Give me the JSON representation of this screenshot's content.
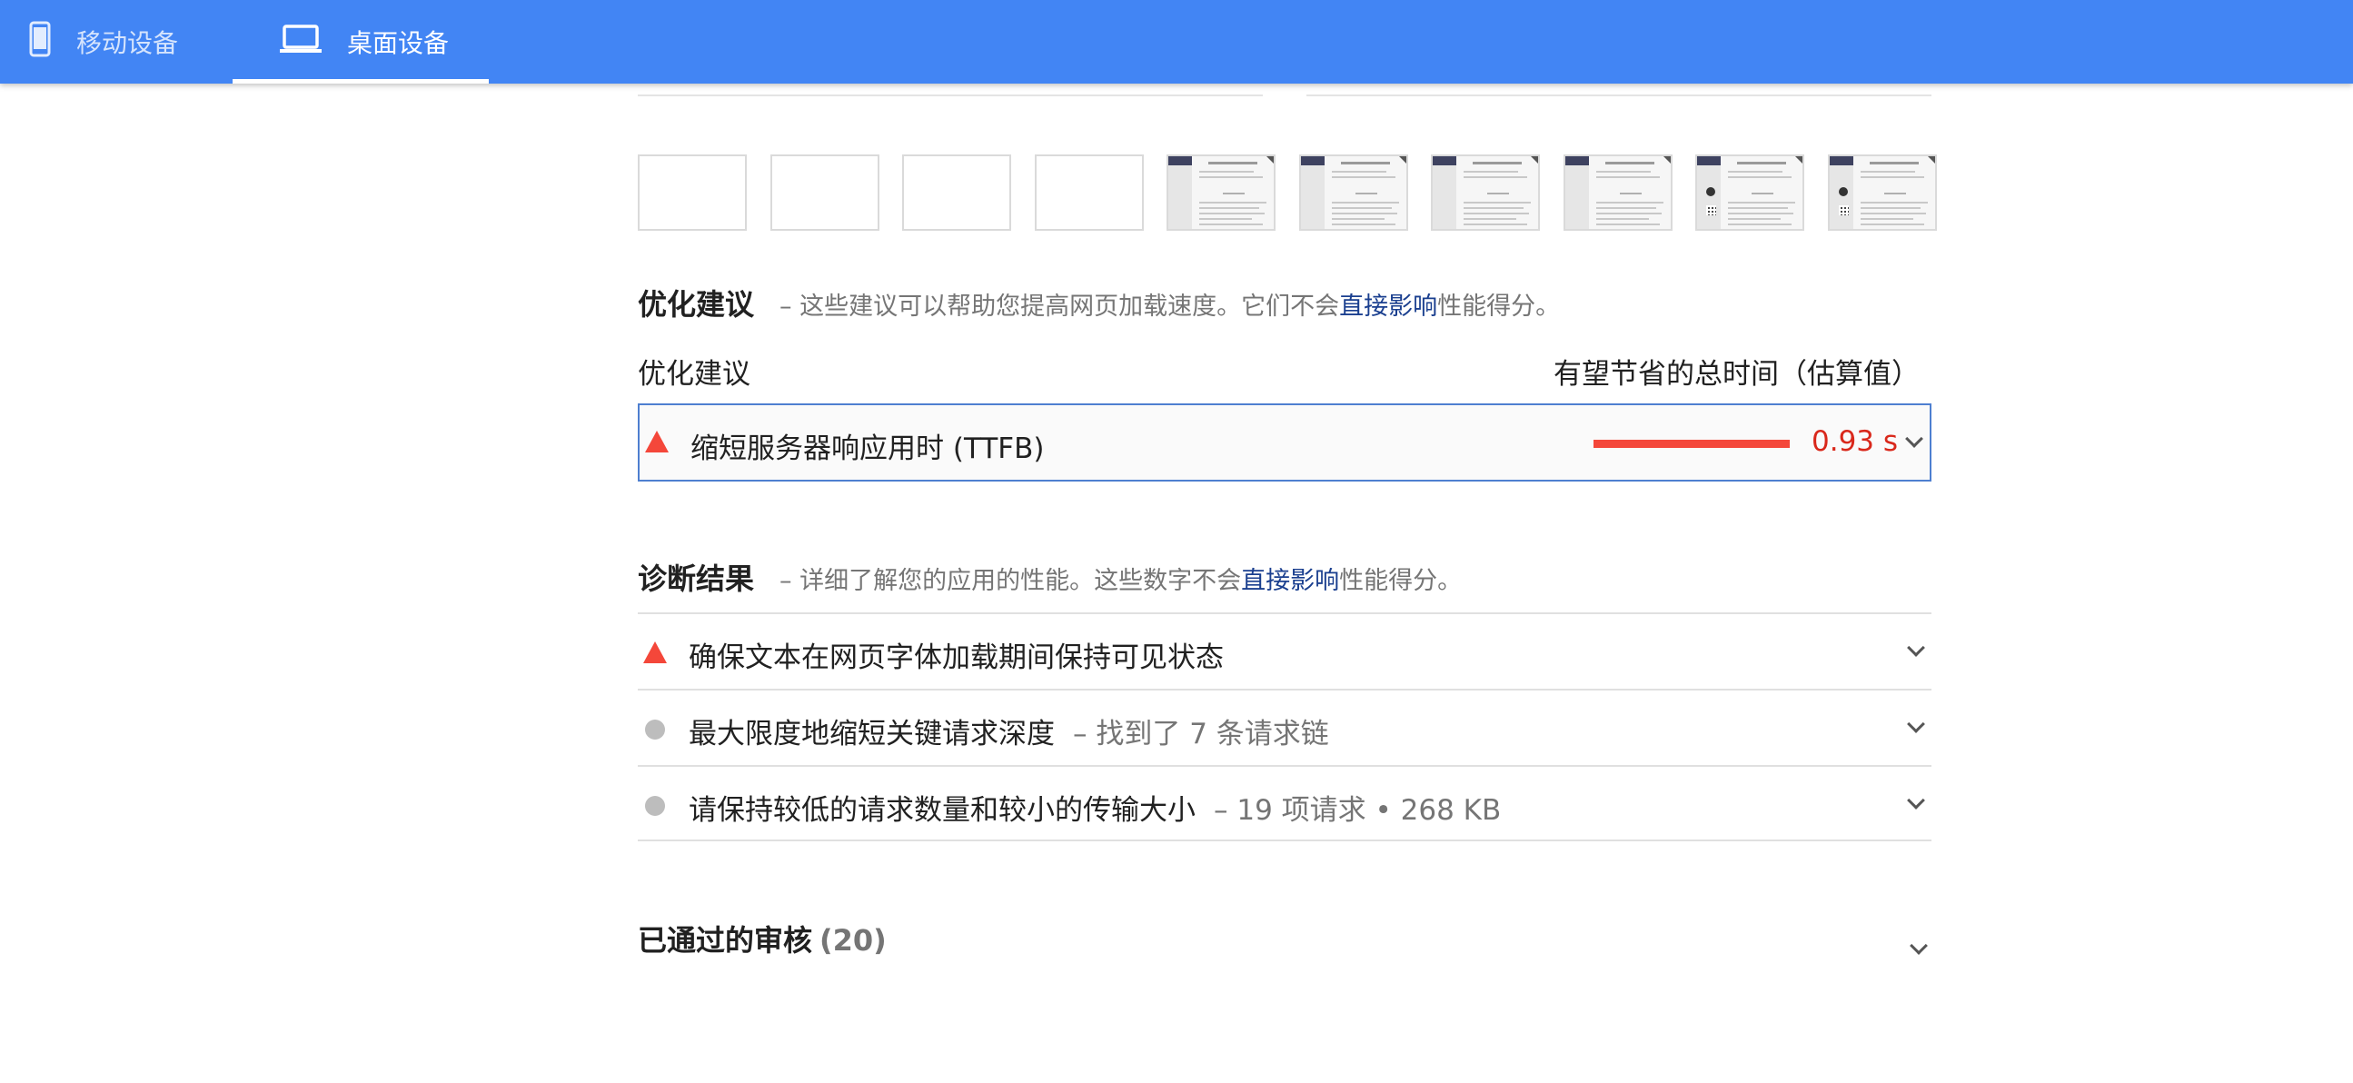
{
  "header": {
    "tabs": [
      {
        "label": "移动设备",
        "icon": "smartphone-icon",
        "active": false
      },
      {
        "label": "桌面设备",
        "icon": "laptop-icon",
        "active": true
      }
    ],
    "color": "#4285f4"
  },
  "filmstrip": {
    "frames": [
      {
        "state": "blank"
      },
      {
        "state": "blank"
      },
      {
        "state": "blank"
      },
      {
        "state": "blank"
      },
      {
        "state": "loaded"
      },
      {
        "state": "loaded"
      },
      {
        "state": "loaded"
      },
      {
        "state": "loaded"
      },
      {
        "state": "loaded-with-avatar"
      },
      {
        "state": "loaded-with-avatar"
      }
    ]
  },
  "opportunities": {
    "title": "优化建议",
    "desc_prefix": "– 这些建议可以帮助您提高网页加载速度。它们不会",
    "desc_link": "直接影响",
    "desc_suffix": "性能得分。",
    "col_left": "优化建议",
    "col_right": "有望节省的总时间（估算值）",
    "items": [
      {
        "title": "缩短服务器响应用时 (TTFB)",
        "value": "0.93 s",
        "status": "fail",
        "fill": 1.0
      }
    ]
  },
  "diagnostics": {
    "title": "诊断结果",
    "desc_prefix": "– 详细了解您的应用的性能。这些数字不会",
    "desc_link": "直接影响",
    "desc_suffix": "性能得分。",
    "items": [
      {
        "title": "确保文本在网页字体加载期间保持可见状态",
        "extra": "",
        "status": "fail"
      },
      {
        "title": "最大限度地缩短关键请求深度",
        "extra": "– 找到了 7 条请求链",
        "status": "info"
      },
      {
        "title": "请保持较低的请求数量和较小的传输大小",
        "extra": "– 19 项请求 • 268 KB",
        "status": "info"
      }
    ]
  },
  "passed": {
    "title": "已通过的审核",
    "count": "(20)"
  },
  "colors": {
    "fail": "#f4473a",
    "fail_text": "#d9281b",
    "info": "#bdbdbd",
    "link": "#1a3f8f"
  }
}
